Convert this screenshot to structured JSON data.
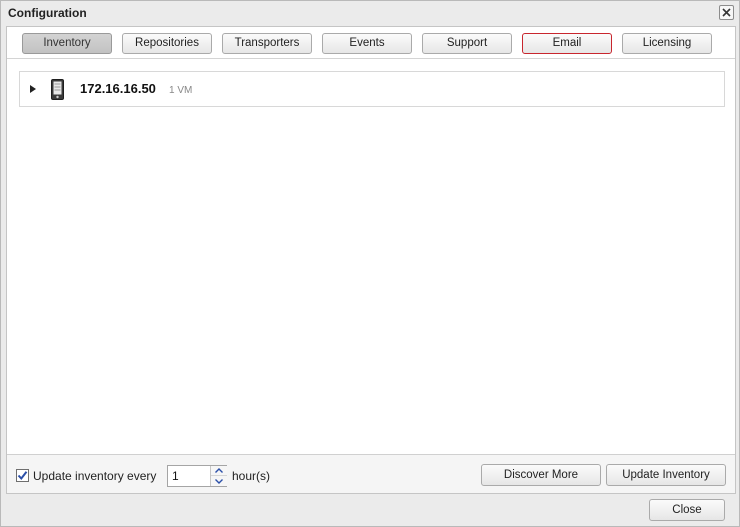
{
  "window": {
    "title": "Configuration",
    "close_label": "Close"
  },
  "tabs": [
    {
      "label": "Inventory",
      "state": "active"
    },
    {
      "label": "Repositories",
      "state": "normal"
    },
    {
      "label": "Transporters",
      "state": "normal"
    },
    {
      "label": "Events",
      "state": "normal"
    },
    {
      "label": "Support",
      "state": "normal"
    },
    {
      "label": "Email",
      "state": "highlighted"
    },
    {
      "label": "Licensing",
      "state": "normal"
    }
  ],
  "inventory": {
    "host": {
      "name": "172.16.16.50",
      "vm_count": "1 VM",
      "icon": "server-icon",
      "expanded": false
    }
  },
  "footer": {
    "update_checkbox_checked": true,
    "update_label": "Update inventory every",
    "interval_value": "1",
    "interval_unit": "hour(s)",
    "discover_button": "Discover More",
    "update_button": "Update Inventory"
  },
  "colors": {
    "highlight_border": "#c8262e",
    "active_tab_bg": "#c8c8c8",
    "checkbox_check": "#2b4fa8"
  }
}
